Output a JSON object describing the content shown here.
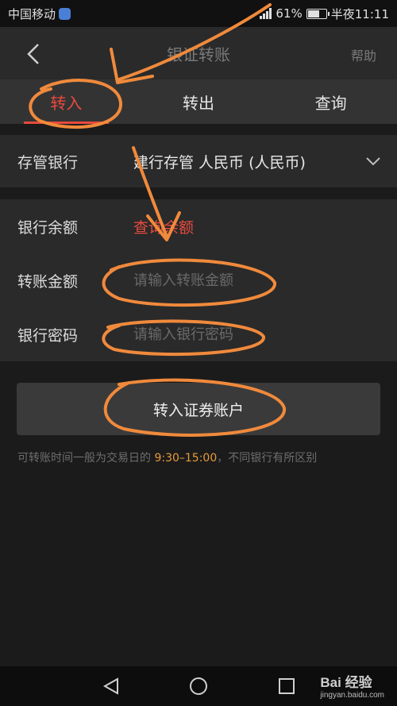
{
  "status_bar": {
    "carrier": "中国移动",
    "battery": "61%",
    "time": "半夜11:11"
  },
  "title_bar": {
    "title": "银证转账",
    "help": "帮助"
  },
  "tabs": [
    {
      "label": "转入",
      "active": true
    },
    {
      "label": "转出",
      "active": false
    },
    {
      "label": "查询",
      "active": false
    }
  ],
  "bank": {
    "label": "存管银行",
    "value": "建行存管 人民币 (人民币)"
  },
  "form": {
    "balance_label": "银行余额",
    "balance_link": "查询余额",
    "amount_label": "转账金额",
    "amount_placeholder": "请输入转账金额",
    "password_label": "银行密码",
    "password_placeholder": "请输入银行密码"
  },
  "submit_label": "转入证券账户",
  "note": {
    "prefix": "可转账时间一般为交易日的 ",
    "time_range": "9:30–15:00",
    "suffix": "，不同银行有所区别"
  },
  "watermark": {
    "brand": "Bai 经验",
    "url": "jingyan.baidu.com"
  },
  "colors": {
    "accent": "#e84a3e",
    "highlight": "#e69a3a",
    "annotation": "#f08a3c"
  }
}
